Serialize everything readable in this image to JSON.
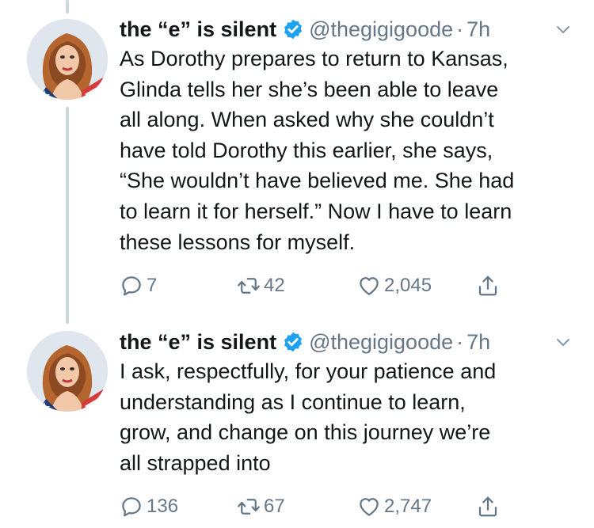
{
  "colors": {
    "text": "#14171a",
    "muted": "#657786",
    "verified": "#1da1f2",
    "thread_line": "#ccd6dd"
  },
  "tweets": [
    {
      "display_name": "the “e” is silent",
      "verified_icon": "verified-badge-icon",
      "handle": "@thegigigoode",
      "dot": "·",
      "time": "7h",
      "body_lines": [
        "As Dorothy prepares to return to Kansas,",
        "Glinda tells her she’s been able to leave",
        "all along. When asked why she couldn’t",
        "have told Dorothy this earlier, she says,",
        "“She wouldn’t have believed me. She had",
        "to learn it for herself.” Now I have to learn",
        "these lessons for myself."
      ],
      "reply_count": "7",
      "retweet_count": "42",
      "like_count": "2,045"
    },
    {
      "display_name": "the “e” is silent",
      "verified_icon": "verified-badge-icon",
      "handle": "@thegigigoode",
      "dot": "·",
      "time": "7h",
      "body_lines": [
        "I ask, respectfully, for your patience and",
        "understanding as I continue to learn,",
        "grow, and change on this journey we’re",
        "all strapped into"
      ],
      "reply_count": "136",
      "retweet_count": "67",
      "like_count": "2,747"
    }
  ]
}
